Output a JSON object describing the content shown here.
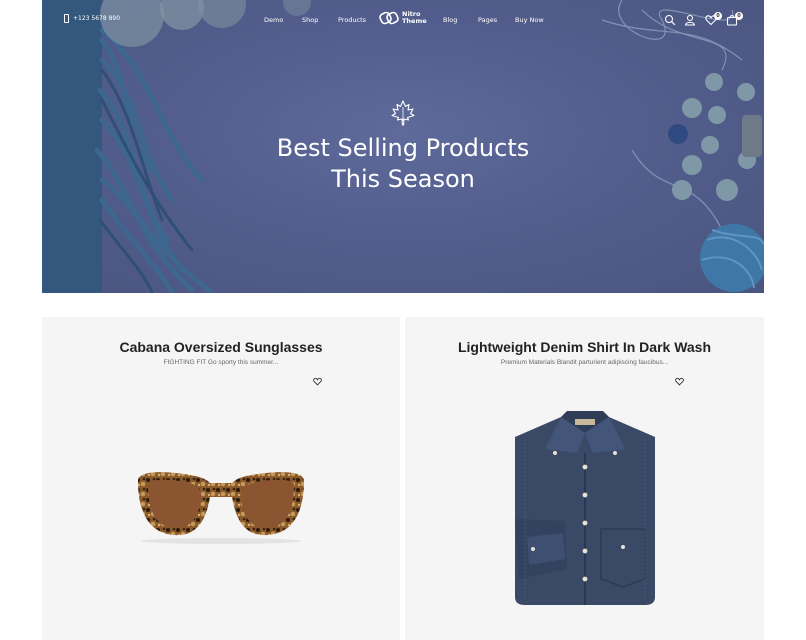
{
  "header": {
    "phone": "+123 5678 890",
    "menu": [
      "Demo",
      "Shop",
      "Products",
      "Blog",
      "Pages",
      "Buy Now"
    ],
    "logo_line1": "Nitro",
    "logo_line2": "Theme",
    "wishlist_count": "0",
    "cart_count": "0"
  },
  "hero": {
    "title_line1": "Best Selling Products",
    "title_line2": "This Season",
    "background_color": "#535e8e"
  },
  "products": [
    {
      "title": "Cabana Oversized Sunglasses",
      "subtitle": "FIGHTING FIT Go sporty this summer...",
      "image": "tortoiseshell-sunglasses"
    },
    {
      "title": "Lightweight Denim Shirt In Dark Wash",
      "subtitle": "Premium Materials Blandit parturient adipiscing faucibus...",
      "image": "folded-denim-shirt"
    }
  ],
  "icons": {
    "search": "search-icon",
    "account": "user-icon",
    "wishlist": "heart-icon",
    "cart": "cart-icon",
    "hero_emblem": "maple-leaf-icon"
  }
}
